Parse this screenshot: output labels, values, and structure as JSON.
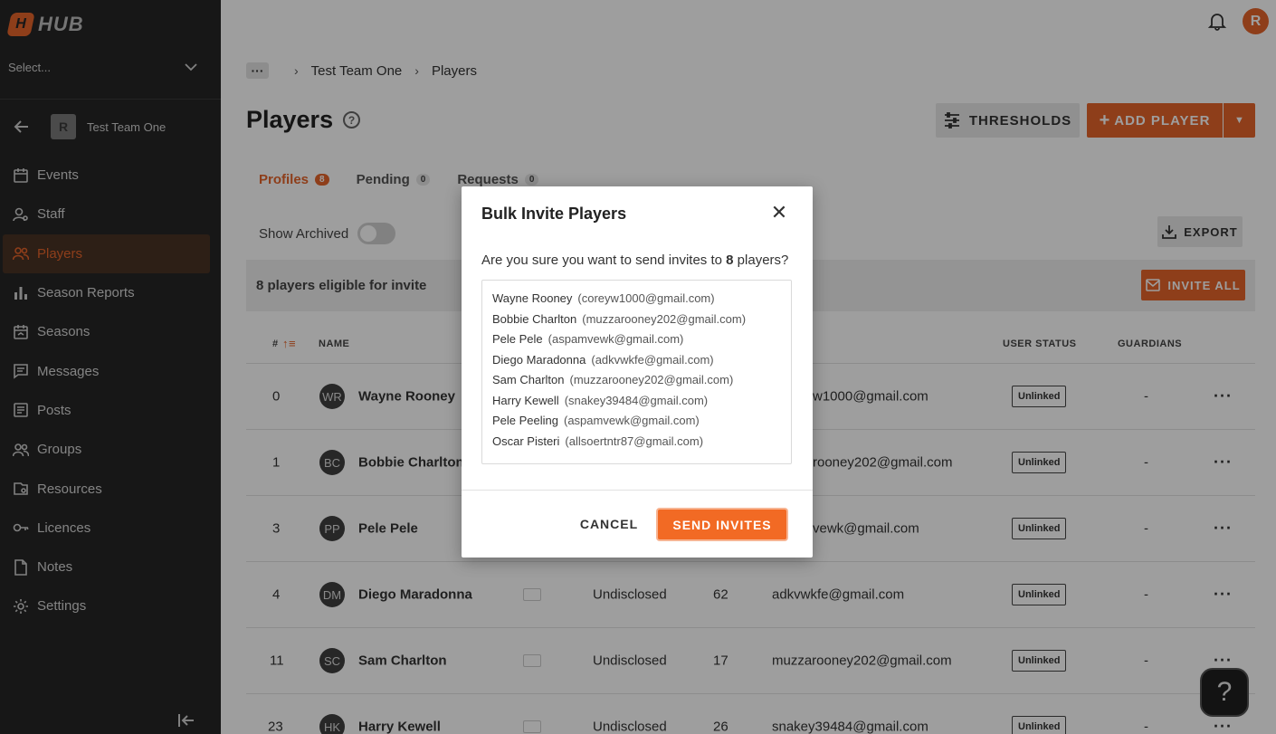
{
  "app": {
    "logo_text": "HUB",
    "logo_mark": "H"
  },
  "sidebar": {
    "org_select_placeholder": "Select...",
    "team": {
      "name": "Test Team One",
      "logo_letter": "R"
    },
    "items": [
      {
        "label": "Events",
        "icon": "calendar-icon"
      },
      {
        "label": "Staff",
        "icon": "staff-icon"
      },
      {
        "label": "Players",
        "icon": "players-icon",
        "active": true
      },
      {
        "label": "Season Reports",
        "icon": "bar-chart-icon"
      },
      {
        "label": "Seasons",
        "icon": "seasons-icon"
      },
      {
        "label": "Messages",
        "icon": "message-icon"
      },
      {
        "label": "Posts",
        "icon": "posts-icon"
      },
      {
        "label": "Groups",
        "icon": "groups-icon"
      },
      {
        "label": "Resources",
        "icon": "resources-icon"
      },
      {
        "label": "Licences",
        "icon": "key-icon"
      },
      {
        "label": "Notes",
        "icon": "notes-icon"
      },
      {
        "label": "Settings",
        "icon": "gear-icon"
      }
    ],
    "accent": "#e5642b"
  },
  "header": {
    "avatar_letter": "R"
  },
  "breadcrumb": {
    "dots": "···",
    "items": [
      "Test Team One",
      "Players"
    ]
  },
  "page": {
    "title": "Players",
    "help": "?",
    "thresholds_label": "THRESHOLDS",
    "add_player_label": "ADD PLAYER",
    "tabs": [
      {
        "label": "Profiles",
        "count": "8"
      },
      {
        "label": "Pending",
        "count": "0"
      },
      {
        "label": "Requests",
        "count": "0"
      }
    ],
    "show_archived_label": "Show Archived",
    "export_label": "EXPORT",
    "eligible_text": "8 players eligible for invite",
    "invite_all_label": "INVITE ALL"
  },
  "table": {
    "headers": {
      "number": "#",
      "name": "NAME",
      "user_status": "USER STATUS",
      "guardians": "GUARDIANS"
    },
    "rows": [
      {
        "number": "0",
        "initials": "WR",
        "name": "Wayne Rooney",
        "gender": "",
        "age": "",
        "email": "w1000@gmail.com",
        "status": "Unlinked",
        "guardians": "-"
      },
      {
        "number": "1",
        "initials": "BC",
        "name": "Bobbie Charlton",
        "gender": "",
        "age": "",
        "email": "rooney202@gmail.com",
        "status": "Unlinked",
        "guardians": "-"
      },
      {
        "number": "3",
        "initials": "PP",
        "name": "Pele Pele",
        "gender": "",
        "age": "",
        "email": "vewk@gmail.com",
        "status": "Unlinked",
        "guardians": "-"
      },
      {
        "number": "4",
        "initials": "DM",
        "name": "Diego Maradonna",
        "gender": "Undisclosed",
        "age": "62",
        "email": "adkvwkfe@gmail.com",
        "status": "Unlinked",
        "guardians": "-"
      },
      {
        "number": "11",
        "initials": "SC",
        "name": "Sam Charlton",
        "gender": "Undisclosed",
        "age": "17",
        "email": "muzzarooney202@gmail.com",
        "status": "Unlinked",
        "guardians": "-"
      },
      {
        "number": "23",
        "initials": "HK",
        "name": "Harry Kewell",
        "gender": "Undisclosed",
        "age": "26",
        "email": "snakey39484@gmail.com",
        "status": "Unlinked",
        "guardians": "-"
      }
    ]
  },
  "help_fab": "?",
  "dialog": {
    "title": "Bulk Invite Players",
    "question_prefix": "Are you sure you want to send invites to",
    "question_count": "8",
    "question_suffix": "players?",
    "players": [
      {
        "name": "Wayne Rooney",
        "email": "(coreyw1000@gmail.com)"
      },
      {
        "name": "Bobbie Charlton",
        "email": "(muzzarooney202@gmail.com)"
      },
      {
        "name": "Pele Pele",
        "email": "(aspamvewk@gmail.com)"
      },
      {
        "name": "Diego Maradonna",
        "email": "(adkvwkfe@gmail.com)"
      },
      {
        "name": "Sam Charlton",
        "email": "(muzzarooney202@gmail.com)"
      },
      {
        "name": "Harry Kewell",
        "email": "(snakey39484@gmail.com)"
      },
      {
        "name": "Pele Peeling",
        "email": "(aspamvewk@gmail.com)"
      },
      {
        "name": "Oscar Pisteri",
        "email": "(allsoertntr87@gmail.com)"
      }
    ],
    "cancel_label": "CANCEL",
    "send_label": "SEND INVITES"
  }
}
